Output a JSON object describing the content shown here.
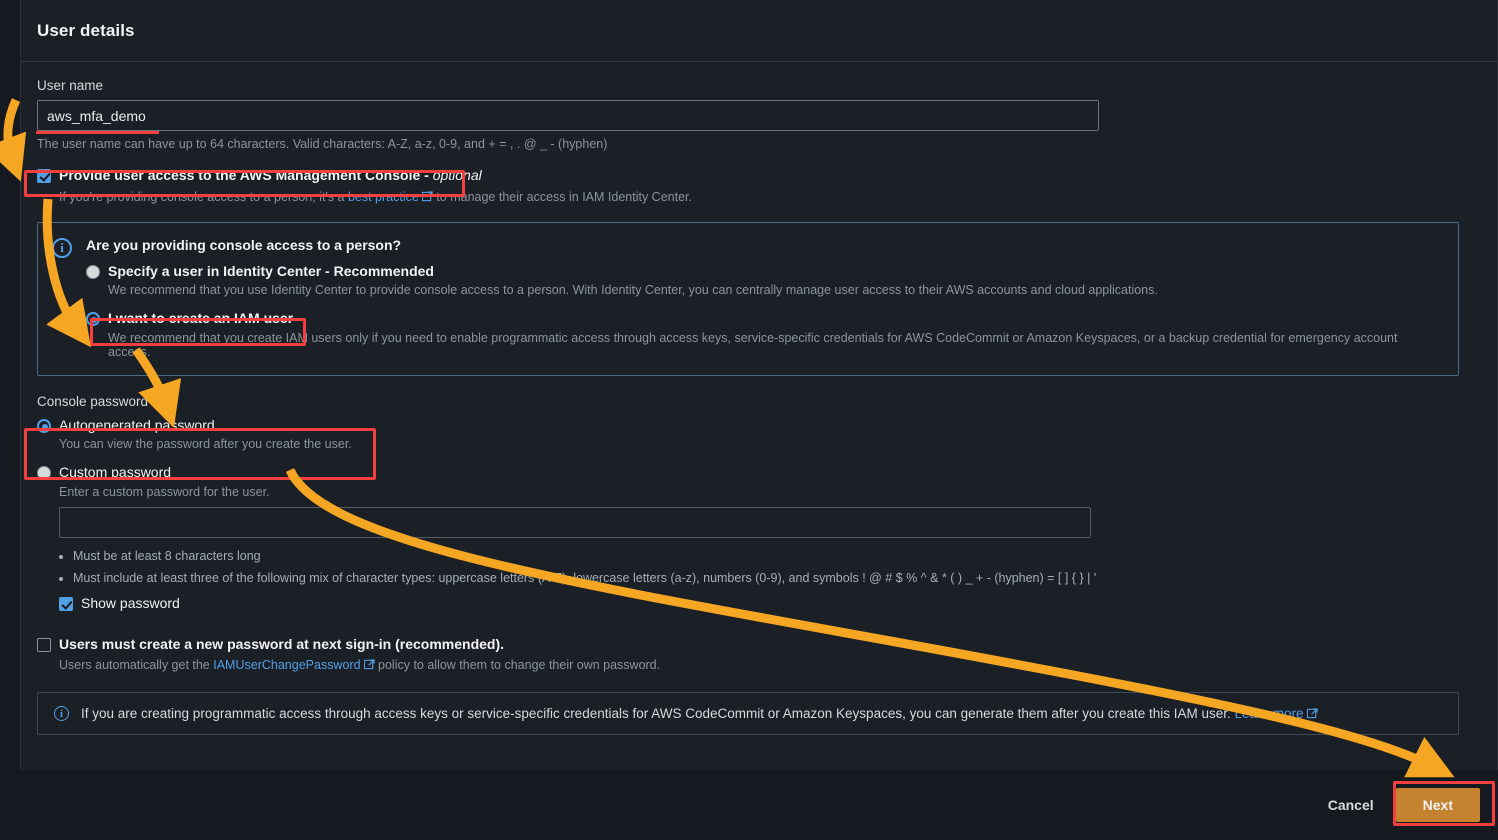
{
  "header": {
    "title": "User details"
  },
  "user_name": {
    "label": "User name",
    "value": "aws_mfa_demo",
    "placeholder": "",
    "hint": "The user name can have up to 64 characters. Valid characters: A-Z, a-z, 0-9, and + = , . @ _ - (hyphen)"
  },
  "console_access": {
    "checkbox_label_main": "Provide user access to the AWS Management Console - ",
    "checkbox_label_optional": "optional",
    "checked": true,
    "hint_before": "If you're providing console access to a person, it's a ",
    "hint_link": "best practice",
    "hint_after": " to manage their access in IAM Identity Center."
  },
  "info_panel": {
    "icon": "info-icon",
    "heading": "Are you providing console access to a person?",
    "options": [
      {
        "label": "Specify a user in Identity Center - Recommended",
        "description": "We recommend that you use Identity Center to provide console access to a person. With Identity Center, you can centrally manage user access to their AWS accounts and cloud applications.",
        "selected": false
      },
      {
        "label": "I want to create an IAM user",
        "description": "We recommend that you create IAM users only if you need to enable programmatic access through access keys, service-specific credentials for AWS CodeCommit or Amazon Keyspaces, or a backup credential for emergency account access.",
        "selected": true
      }
    ]
  },
  "console_password": {
    "label": "Console password",
    "options": [
      {
        "label": "Autogenerated password",
        "description": "You can view the password after you create the user.",
        "selected": true
      },
      {
        "label": "Custom password",
        "description": "Enter a custom password for the user.",
        "selected": false
      }
    ],
    "custom_password_value": "",
    "custom_password_placeholder": "",
    "requirements": [
      "Must be at least 8 characters long",
      "Must include at least three of the following mix of character types: uppercase letters (A-Z), lowercase letters (a-z), numbers (0-9), and symbols ! @ # $ % ^ & * ( ) _ + - (hyphen) = [ ] { } | '"
    ],
    "show_password_label": "Show password",
    "show_password_checked": true
  },
  "next_signin": {
    "label": "Users must create a new password at next sign-in (recommended).",
    "checked": false,
    "hint_before": "Users automatically get the ",
    "hint_link": "IAMUserChangePassword",
    "hint_after": " policy to allow them to change their own password."
  },
  "alert": {
    "icon": "info-icon",
    "text": "If you are creating programmatic access through access keys or service-specific credentials for AWS CodeCommit or Amazon Keyspaces, you can generate them after you create this IAM user. ",
    "link": "Learn more"
  },
  "footer": {
    "cancel_label": "Cancel",
    "next_label": "Next"
  },
  "colors": {
    "accent_blue": "#539fe5",
    "annotation_red": "#f43f3f",
    "annotation_orange": "#f5a623",
    "button_orange": "#c5832f",
    "page_bg": "#16191f",
    "card_bg": "#1b1f26"
  }
}
